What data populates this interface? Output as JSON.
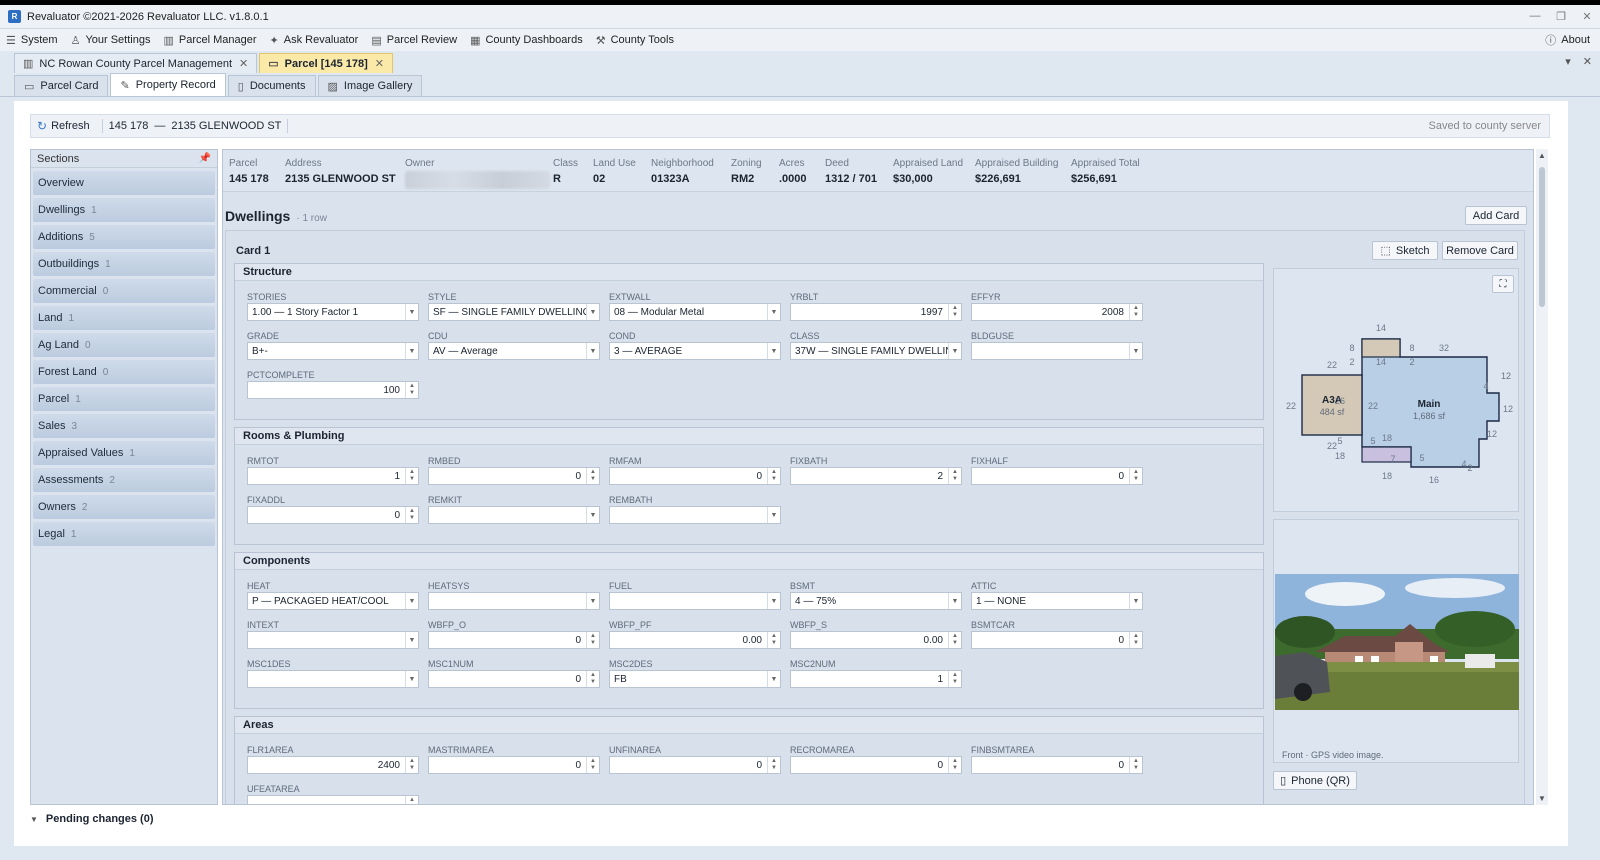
{
  "app": {
    "title": "Revaluator ©2021-2026 Revaluator LLC. v1.8.0.1",
    "icon": "app-logo-icon"
  },
  "menu": [
    {
      "label": "System",
      "icon": "sliders-icon"
    },
    {
      "label": "Your Settings",
      "icon": "user-icon"
    },
    {
      "label": "Parcel Manager",
      "icon": "map-icon"
    },
    {
      "label": "Ask Revaluator",
      "icon": "sparkle-icon"
    },
    {
      "label": "Parcel Review",
      "icon": "clipboard-icon"
    },
    {
      "label": "County Dashboards",
      "icon": "grid-icon"
    },
    {
      "label": "County Tools",
      "icon": "wrench-icon"
    }
  ],
  "about": "About",
  "doc_tabs": [
    {
      "label": "NC Rowan County Parcel Management",
      "active": false
    },
    {
      "label": "Parcel [145 178]",
      "active": true
    }
  ],
  "sub_tabs": [
    {
      "label": "Parcel Card",
      "active": false
    },
    {
      "label": "Property Record",
      "active": true
    },
    {
      "label": "Documents",
      "active": false
    },
    {
      "label": "Image Gallery",
      "active": false
    }
  ],
  "toolbar": {
    "refresh": "Refresh",
    "parcel": "145 178",
    "dash": "—",
    "address": "2135 GLENWOOD ST",
    "saved": "Saved to county server"
  },
  "sections": {
    "header": "Sections",
    "items": [
      {
        "label": "Overview",
        "count": ""
      },
      {
        "label": "Dwellings",
        "count": "1"
      },
      {
        "label": "Additions",
        "count": "5"
      },
      {
        "label": "Outbuildings",
        "count": "1"
      },
      {
        "label": "Commercial",
        "count": "0"
      },
      {
        "label": "Land",
        "count": "1"
      },
      {
        "label": "Ag Land",
        "count": "0"
      },
      {
        "label": "Forest Land",
        "count": "0"
      },
      {
        "label": "Parcel",
        "count": "1"
      },
      {
        "label": "Sales",
        "count": "3"
      },
      {
        "label": "Appraised Values",
        "count": "1"
      },
      {
        "label": "Assessments",
        "count": "2"
      },
      {
        "label": "Owners",
        "count": "2"
      },
      {
        "label": "Legal",
        "count": "1"
      }
    ]
  },
  "summary": [
    {
      "label": "Parcel",
      "value": "145 178"
    },
    {
      "label": "Address",
      "value": "2135 GLENWOOD ST"
    },
    {
      "label": "Owner",
      "value": ""
    },
    {
      "label": "Class",
      "value": "R"
    },
    {
      "label": "Land Use",
      "value": "02"
    },
    {
      "label": "Neighborhood",
      "value": "01323A"
    },
    {
      "label": "Zoning",
      "value": "RM2"
    },
    {
      "label": "Acres",
      "value": ".0000"
    },
    {
      "label": "Deed",
      "value": "1312 / 701"
    },
    {
      "label": "Appraised Land",
      "value": "$30,000"
    },
    {
      "label": "Appraised Building",
      "value": "$226,691"
    },
    {
      "label": "Appraised Total",
      "value": "$256,691"
    }
  ],
  "dwellings": {
    "title": "Dwellings",
    "rows": "· 1 row",
    "add_card": "Add Card",
    "card_title": "Card 1",
    "sketch": "Sketch",
    "remove_card": "Remove Card"
  },
  "groups": {
    "structure": {
      "title": "Structure",
      "rows": [
        [
          {
            "label": "STORIES",
            "value": "1.00 — 1 Story Factor 1",
            "kind": "drop"
          },
          {
            "label": "STYLE",
            "value": "SF — SINGLE FAMILY DWELLING...",
            "kind": "drop"
          },
          {
            "label": "EXTWALL",
            "value": "08 — Modular Metal",
            "kind": "drop"
          },
          {
            "label": "YRBLT",
            "value": "1997",
            "kind": "spin"
          },
          {
            "label": "EFFYR",
            "value": "2008",
            "kind": "spin"
          }
        ],
        [
          {
            "label": "GRADE",
            "value": "B+-",
            "kind": "drop"
          },
          {
            "label": "CDU",
            "value": "AV — Average",
            "kind": "drop"
          },
          {
            "label": "COND",
            "value": "3 — AVERAGE",
            "kind": "drop"
          },
          {
            "label": "CLASS",
            "value": "37W — SINGLE FAMILY DWELLING",
            "kind": "drop"
          },
          {
            "label": "BLDGUSE",
            "value": "",
            "kind": "drop"
          }
        ],
        [
          {
            "label": "PCTCOMPLETE",
            "value": "100",
            "kind": "spin"
          }
        ]
      ]
    },
    "rooms": {
      "title": "Rooms & Plumbing",
      "rows": [
        [
          {
            "label": "RMTOT",
            "value": "1",
            "kind": "spin"
          },
          {
            "label": "RMBED",
            "value": "0",
            "kind": "spin"
          },
          {
            "label": "RMFAM",
            "value": "0",
            "kind": "spin"
          },
          {
            "label": "FIXBATH",
            "value": "2",
            "kind": "spin"
          },
          {
            "label": "FIXHALF",
            "value": "0",
            "kind": "spin"
          }
        ],
        [
          {
            "label": "FIXADDL",
            "value": "0",
            "kind": "spin"
          },
          {
            "label": "REMKIT",
            "value": "",
            "kind": "drop"
          },
          {
            "label": "REMBATH",
            "value": "",
            "kind": "drop"
          }
        ]
      ]
    },
    "components": {
      "title": "Components",
      "rows": [
        [
          {
            "label": "HEAT",
            "value": "P — PACKAGED HEAT/COOL",
            "kind": "drop"
          },
          {
            "label": "HEATSYS",
            "value": "",
            "kind": "drop"
          },
          {
            "label": "FUEL",
            "value": "",
            "kind": "drop"
          },
          {
            "label": "BSMT",
            "value": "4 — 75%",
            "kind": "drop"
          },
          {
            "label": "ATTIC",
            "value": "1 — NONE",
            "kind": "drop"
          }
        ],
        [
          {
            "label": "INTEXT",
            "value": "",
            "kind": "drop"
          },
          {
            "label": "WBFP_O",
            "value": "0",
            "kind": "spin"
          },
          {
            "label": "WBFP_PF",
            "value": "0.00",
            "kind": "spin"
          },
          {
            "label": "WBFP_S",
            "value": "0.00",
            "kind": "spin"
          },
          {
            "label": "BSMTCAR",
            "value": "0",
            "kind": "spin"
          }
        ],
        [
          {
            "label": "MSC1DES",
            "value": "",
            "kind": "drop"
          },
          {
            "label": "MSC1NUM",
            "value": "0",
            "kind": "spin"
          },
          {
            "label": "MSC2DES",
            "value": "FB",
            "kind": "drop"
          },
          {
            "label": "MSC2NUM",
            "value": "1",
            "kind": "spin"
          }
        ]
      ]
    },
    "areas": {
      "title": "Areas",
      "rows": [
        [
          {
            "label": "FLR1AREA",
            "value": "2400",
            "kind": "spin"
          },
          {
            "label": "MASTRIMAREA",
            "value": "0",
            "kind": "spin"
          },
          {
            "label": "UNFINAREA",
            "value": "0",
            "kind": "spin"
          },
          {
            "label": "RECROMAREA",
            "value": "0",
            "kind": "spin"
          },
          {
            "label": "FINBSMTAREA",
            "value": "0",
            "kind": "spin"
          }
        ],
        [
          {
            "label": "UFEATAREA",
            "value": "",
            "kind": "spin"
          }
        ]
      ]
    }
  },
  "sketch": {
    "main_label": "Main",
    "main_area": "1,686 sf",
    "add_label": "A3A",
    "add_area": "484 sf",
    "dims": [
      "14",
      "8",
      "8",
      "32",
      "22",
      "2",
      "12",
      "2",
      "14",
      "22",
      "26",
      "22",
      "12",
      "22",
      "18",
      "12",
      "5",
      "5",
      "7",
      "5",
      "4",
      "2",
      "18",
      "16",
      "18",
      "4"
    ]
  },
  "photo": {
    "caption": "Front · GPS video image.",
    "phone_button": "Phone (QR)"
  },
  "pending": "Pending changes (0)"
}
